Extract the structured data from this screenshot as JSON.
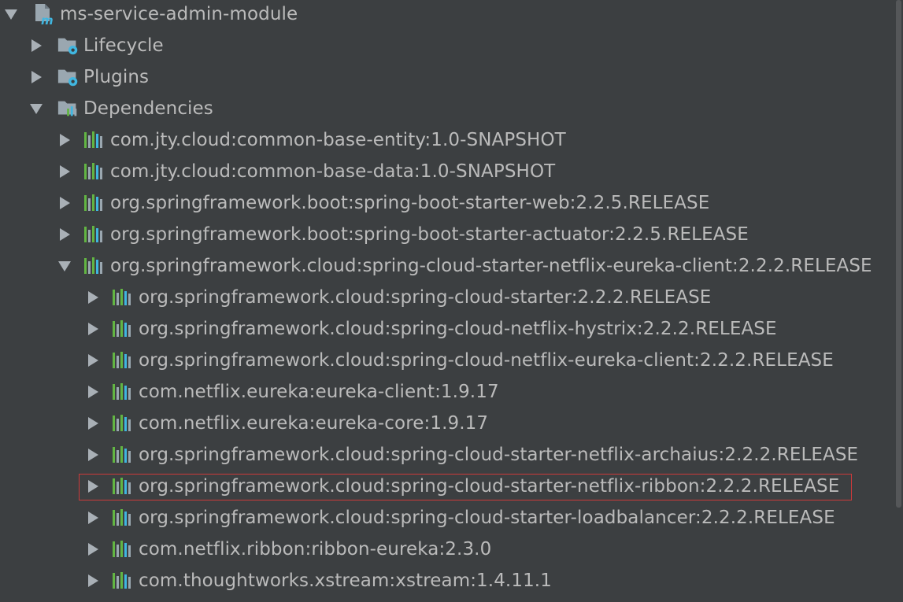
{
  "root": {
    "label": "ms-service-admin-module",
    "expanded": true
  },
  "nodes": [
    {
      "label": "Lifecycle",
      "icon": "lifecycle-folder-icon",
      "expanded": false
    },
    {
      "label": "Plugins",
      "icon": "plugins-folder-icon",
      "expanded": false
    },
    {
      "label": "Dependencies",
      "icon": "dependencies-folder-icon",
      "expanded": true
    }
  ],
  "dependencies": [
    {
      "label": "com.jty.cloud:common-base-entity:1.0-SNAPSHOT",
      "expanded": false
    },
    {
      "label": "com.jty.cloud:common-base-data:1.0-SNAPSHOT",
      "expanded": false
    },
    {
      "label": "org.springframework.boot:spring-boot-starter-web:2.2.5.RELEASE",
      "expanded": false
    },
    {
      "label": "org.springframework.boot:spring-boot-starter-actuator:2.2.5.RELEASE",
      "expanded": false
    },
    {
      "label": "org.springframework.cloud:spring-cloud-starter-netflix-eureka-client:2.2.2.RELEASE",
      "expanded": true
    }
  ],
  "transitive": [
    {
      "label": "org.springframework.cloud:spring-cloud-starter:2.2.2.RELEASE",
      "highlighted": false
    },
    {
      "label": "org.springframework.cloud:spring-cloud-netflix-hystrix:2.2.2.RELEASE",
      "highlighted": false
    },
    {
      "label": "org.springframework.cloud:spring-cloud-netflix-eureka-client:2.2.2.RELEASE",
      "highlighted": false
    },
    {
      "label": "com.netflix.eureka:eureka-client:1.9.17",
      "highlighted": false
    },
    {
      "label": "com.netflix.eureka:eureka-core:1.9.17",
      "highlighted": false
    },
    {
      "label": "org.springframework.cloud:spring-cloud-starter-netflix-archaius:2.2.2.RELEASE",
      "highlighted": false
    },
    {
      "label": "org.springframework.cloud:spring-cloud-starter-netflix-ribbon:2.2.2.RELEASE",
      "highlighted": true
    },
    {
      "label": "org.springframework.cloud:spring-cloud-starter-loadbalancer:2.2.2.RELEASE",
      "highlighted": false
    },
    {
      "label": "com.netflix.ribbon:ribbon-eureka:2.3.0",
      "highlighted": false
    },
    {
      "label": "com.thoughtworks.xstream:xstream:1.4.11.1",
      "highlighted": false
    }
  ],
  "colors": {
    "background": "#3c3f41",
    "text": "#bbbbbb",
    "arrow": "#a9b0b6",
    "highlight_border": "#cc3a3a",
    "library_bar_green": "#62b543",
    "library_bar_blue": "#40b6e0",
    "library_bar_grey": "#9aa7b0"
  }
}
